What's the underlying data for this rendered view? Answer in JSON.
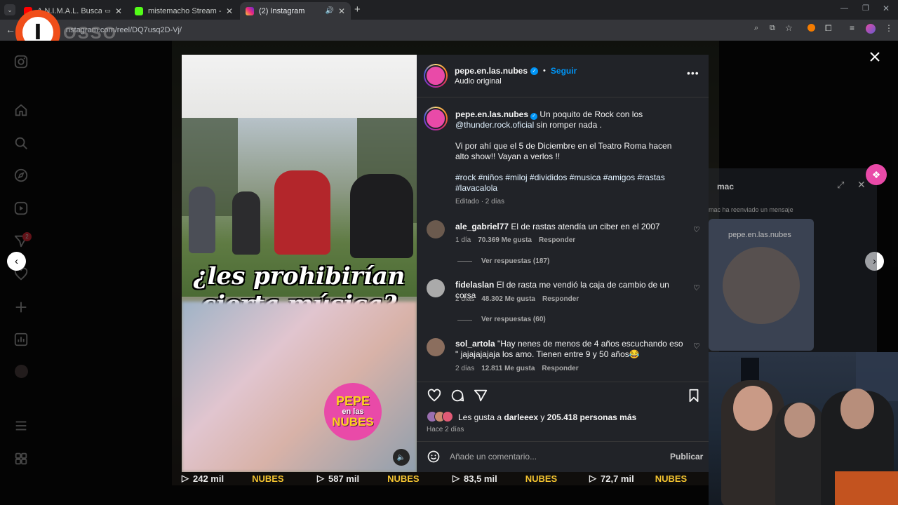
{
  "browser": {
    "tabs": [
      {
        "title": "A.N.I.M.A.L. Buscando Llega",
        "fav_color": "#ff0000"
      },
      {
        "title": "mistemacho Stream - Watch Li",
        "fav_color": "#53fc18"
      },
      {
        "title": "(2) Instagram",
        "fav_color": "#e1306c"
      }
    ],
    "new_tab": "+",
    "url": "nstagram.com/reel/DQ7usq2D-Vj/",
    "watermark": "OSSO"
  },
  "sidebar": {
    "notification_count": "2"
  },
  "video": {
    "question_line1": "¿les prohibirían",
    "question_line2": "cierta música?",
    "logo": [
      "PEPE",
      "en las",
      "NUBES"
    ]
  },
  "header": {
    "username": "pepe.en.las.nubes",
    "follow": "Seguir",
    "audio": "Audio original",
    "dot": "•"
  },
  "caption": {
    "username": "pepe.en.las.nubes",
    "text1": " Un poquito de Rock con los",
    "mention": "@thunder.rock.oficial",
    "text2": " sin romper nada .",
    "para2": "Vi por ahí que el 5 de Diciembre en el Teatro Roma hacen alto show!! Vayan a verlos !!",
    "tags1": "#rock #niños #miloj #divididos #musica #amigos #rastas",
    "tags2": "#lavacalola",
    "meta": "Editado · 2 días"
  },
  "comments": [
    {
      "user": "ale_gabriel77",
      "text": "El de rastas atendía un ciber en el 2007",
      "time": "1 día",
      "likes": "70.369 Me gusta",
      "reply": "Responder",
      "replies": "Ver respuestas (187)"
    },
    {
      "user": "fidelaslan",
      "text": "El de rasta me vendió la caja de cambio de un corsa",
      "time": "2 días",
      "likes": "48.302 Me gusta",
      "reply": "Responder",
      "replies": "Ver respuestas (60)"
    },
    {
      "user": "sol_artola",
      "text": "\"Hay nenes de menos de 4 años escuchando eso \" jajajajajaja los amo. Tienen entre 9 y 50 años😂",
      "time": "2 días",
      "likes": "12.811 Me gusta",
      "reply": "Responder"
    }
  ],
  "likes": {
    "prefix": "Les gusta a ",
    "user": "darleeex",
    "mid": " y ",
    "count": "205.418 personas más",
    "when": "Hace 2 días"
  },
  "add_comment": {
    "placeholder": "Añade un comentario...",
    "publish": "Publicar"
  },
  "background": {
    "views": [
      "242 mil",
      "587 mil",
      "83,5 mil",
      "72,7 mil"
    ],
    "brand": "NUBES"
  },
  "side_chat": {
    "title": "mac",
    "forwarded": "mac ha reenviado un mensaje",
    "preview_user": "pepe.en.las.nubes"
  },
  "colors": {
    "panel": "#212328",
    "accent": "#0095f6",
    "verified": "#0095f6",
    "chrome": "#202124"
  }
}
